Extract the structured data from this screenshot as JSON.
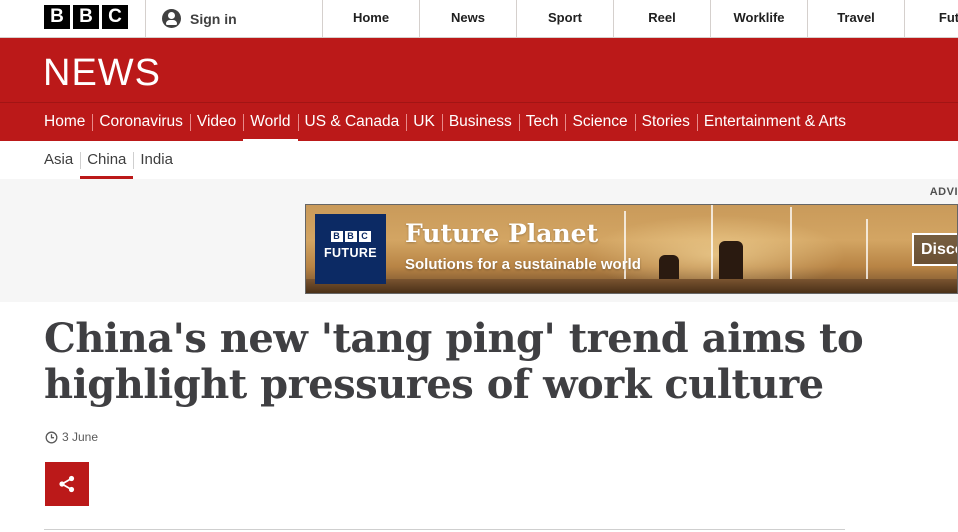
{
  "brand": {
    "letters": [
      "B",
      "B",
      "C"
    ]
  },
  "account": {
    "signin_label": "Sign in"
  },
  "global_nav": [
    "Home",
    "News",
    "Sport",
    "Reel",
    "Worklife",
    "Travel",
    "Futu"
  ],
  "section_title": "NEWS",
  "news_nav": [
    {
      "label": "Home",
      "active": false
    },
    {
      "label": "Coronavirus",
      "active": false
    },
    {
      "label": "Video",
      "active": false
    },
    {
      "label": "World",
      "active": true
    },
    {
      "label": "US & Canada",
      "active": false
    },
    {
      "label": "UK",
      "active": false
    },
    {
      "label": "Business",
      "active": false
    },
    {
      "label": "Tech",
      "active": false
    },
    {
      "label": "Science",
      "active": false
    },
    {
      "label": "Stories",
      "active": false
    },
    {
      "label": "Entertainment & Arts",
      "active": false
    }
  ],
  "sub_nav": [
    {
      "label": "Asia",
      "active": false
    },
    {
      "label": "China",
      "active": true
    },
    {
      "label": "India",
      "active": false
    }
  ],
  "advert": {
    "label": "ADVI",
    "logo_letters": [
      "B",
      "B",
      "C"
    ],
    "logo_word": "FUTURE",
    "title": "Future Planet",
    "subtitle": "Solutions for a sustainable world",
    "cta": "Disco"
  },
  "article": {
    "headline": "China's new 'tang ping' trend aims to highlight pressures of work culture",
    "date": "3 June"
  },
  "icons": {
    "user": "user-icon",
    "clock": "clock-icon",
    "share": "share-icon"
  },
  "colors": {
    "brand_red": "#bb1919",
    "advert_navy": "#0c2a64",
    "headline_text": "#3f3f42"
  }
}
